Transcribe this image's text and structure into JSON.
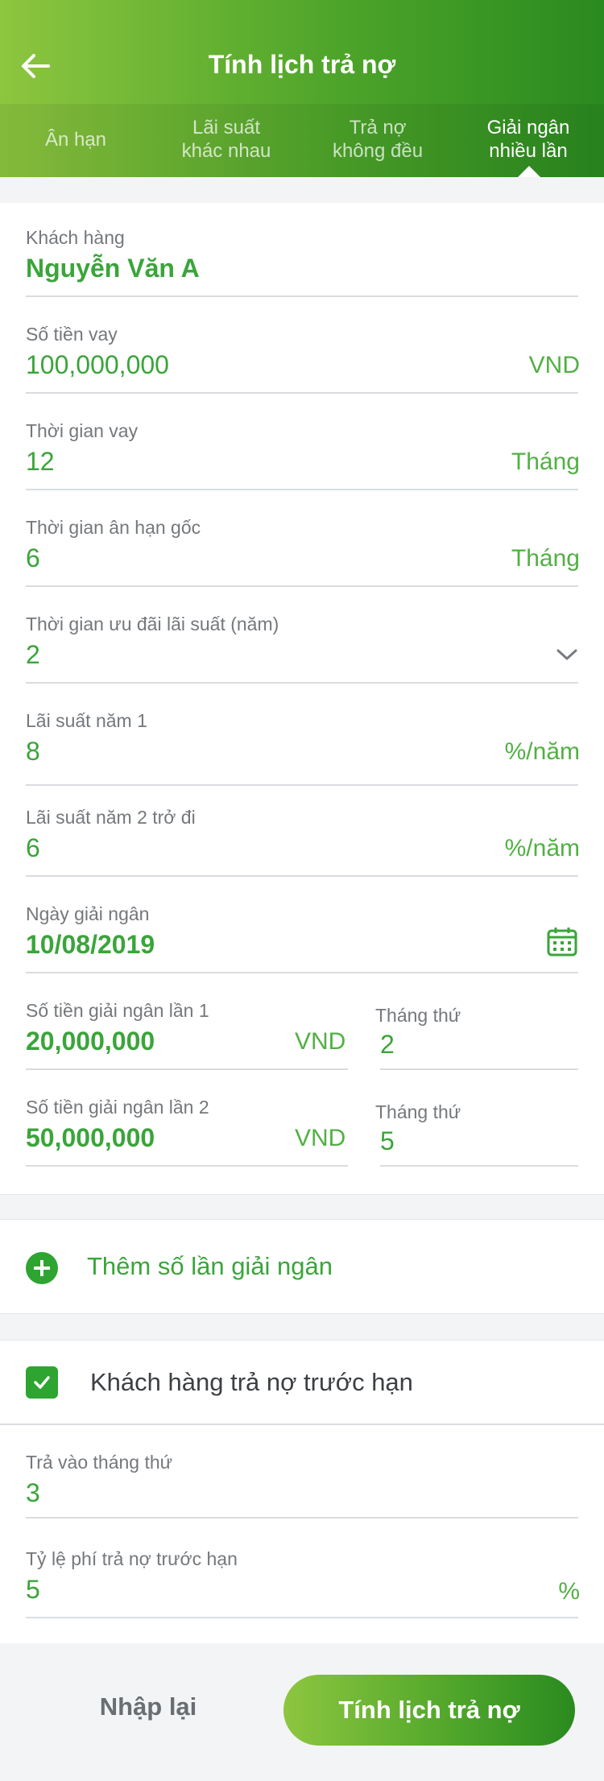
{
  "header": {
    "title": "Tính lịch trả nợ"
  },
  "tabs": [
    {
      "label": "Ân hạn"
    },
    {
      "label": "Lãi suất\nkhác nhau"
    },
    {
      "label": "Trả nợ\nkhông đều"
    },
    {
      "label": "Giải ngân\nnhiều lần"
    }
  ],
  "form": {
    "customer": {
      "label": "Khách hàng",
      "value": "Nguyễn Văn A"
    },
    "loan_amount": {
      "label": "Số tiền vay",
      "value": "100,000,000",
      "unit": "VND"
    },
    "loan_term": {
      "label": "Thời gian vay",
      "value": "12",
      "unit": "Tháng"
    },
    "grace": {
      "label": "Thời gian ân hạn gốc",
      "value": "6",
      "unit": "Tháng"
    },
    "promo": {
      "label": "Thời gian ưu đãi lãi suất (năm)",
      "value": "2"
    },
    "rate1": {
      "label": "Lãi suất năm 1",
      "value": "8",
      "unit": "%/năm"
    },
    "rate2": {
      "label": "Lãi suất năm 2  trở đi",
      "value": "6",
      "unit": "%/năm"
    },
    "disbursement_date": {
      "label": "Ngày giải ngân",
      "value": "10/08/2019"
    },
    "disbursements": [
      {
        "amount_label": "Số tiền giải ngân lần 1",
        "amount": "20,000,000",
        "unit": "VND",
        "month_label": "Tháng thứ",
        "month": "2"
      },
      {
        "amount_label": "Số tiền giải ngân lần 2",
        "amount": "50,000,000",
        "unit": "VND",
        "month_label": "Tháng thứ",
        "month": "5"
      }
    ]
  },
  "add_disbursement": {
    "label": "Thêm số lần giải ngân"
  },
  "prepay": {
    "checkbox_label": "Khách hàng trả nợ trước hạn",
    "checked": true,
    "month": {
      "label": "Trả vào tháng thứ",
      "value": "3"
    },
    "fee": {
      "label": "Tỷ lệ phí trả nợ trước hạn",
      "value": "5",
      "unit": "%"
    }
  },
  "footer": {
    "reset_label": "Nhập lại",
    "submit_label": "Tính lịch trả nợ"
  },
  "colors": {
    "brand_green": "#3aa53a",
    "gradient_start": "#8dc63f",
    "gradient_end": "#2a8a1f"
  }
}
